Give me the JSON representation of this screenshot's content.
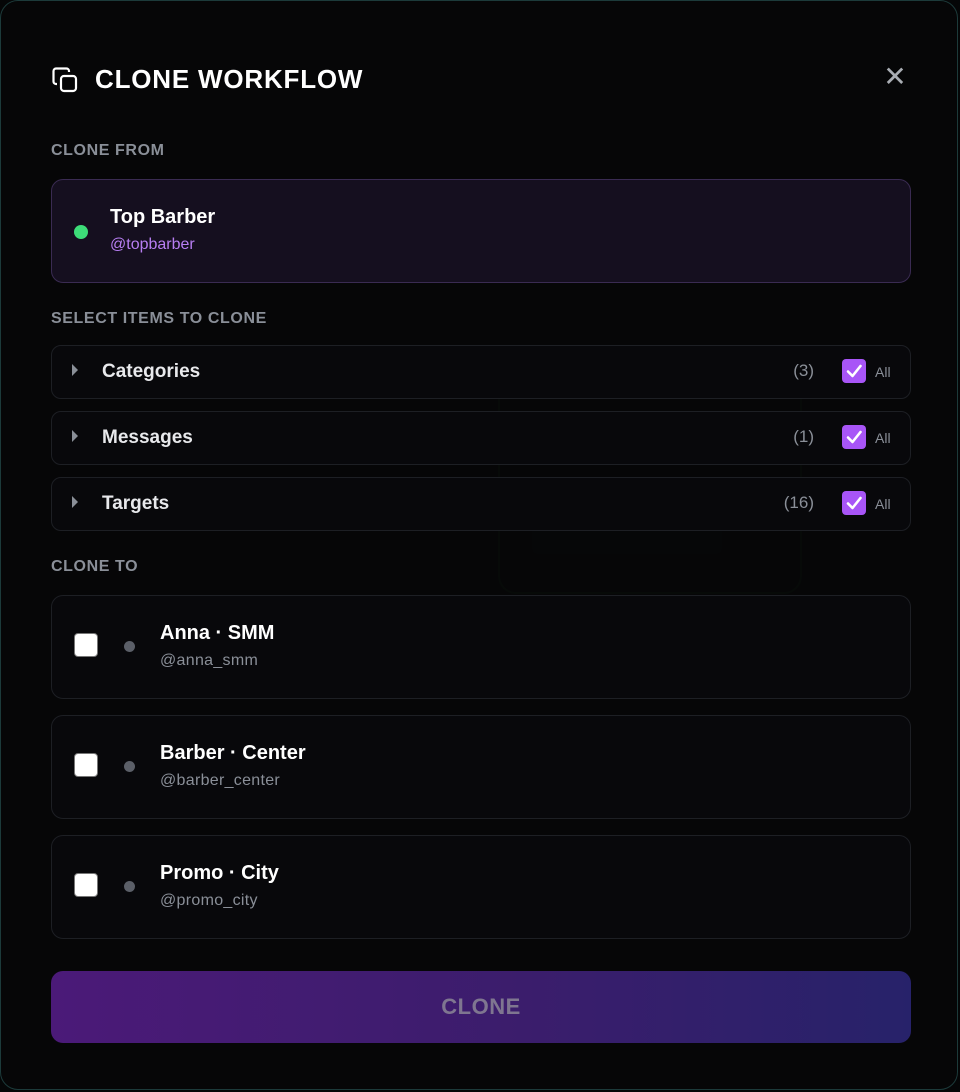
{
  "modal": {
    "title": "CLONE WORKFLOW",
    "close_icon": "close-icon",
    "title_icon": "copy-icon"
  },
  "clone_from": {
    "label": "CLONE FROM",
    "name": "Top Barber",
    "handle": "@topbarber",
    "status_color": "#3ddc78"
  },
  "select_items": {
    "label": "SELECT ITEMS TO CLONE",
    "items": [
      {
        "label": "Categories",
        "count": "(3)",
        "all_label": "All",
        "checked": true
      },
      {
        "label": "Messages",
        "count": "(1)",
        "all_label": "All",
        "checked": true
      },
      {
        "label": "Targets",
        "count": "(16)",
        "all_label": "All",
        "checked": true
      }
    ]
  },
  "clone_to": {
    "label": "CLONE TO",
    "targets": [
      {
        "name": "Anna · SMM",
        "handle": "@anna_smm",
        "checked": false
      },
      {
        "name": "Barber · Center",
        "handle": "@barber_center",
        "checked": false
      },
      {
        "name": "Promo · City",
        "handle": "@promo_city",
        "checked": false
      }
    ]
  },
  "actions": {
    "clone_label": "CLONE"
  },
  "colors": {
    "accent": "#a855f7",
    "handle_accent": "#b77ef2"
  }
}
